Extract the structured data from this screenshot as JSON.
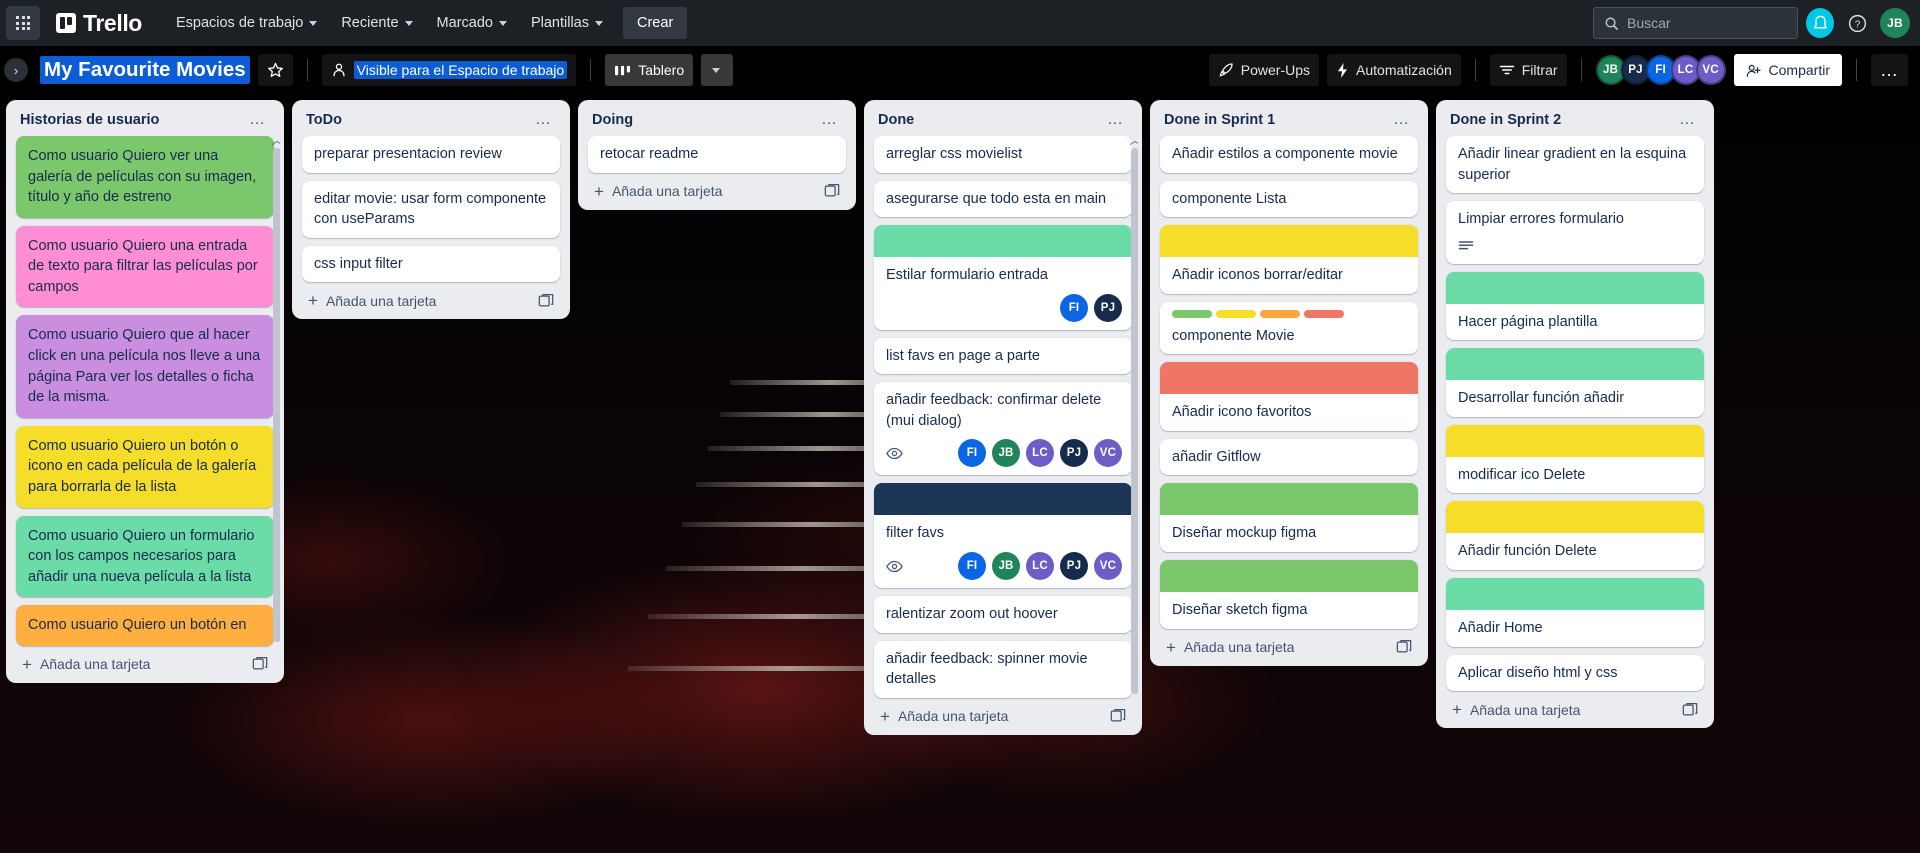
{
  "topnav": {
    "apps_label": "apps",
    "brand": "Trello",
    "items": [
      {
        "label": "Espacios de trabajo"
      },
      {
        "label": "Reciente"
      },
      {
        "label": "Marcado"
      },
      {
        "label": "Plantillas"
      }
    ],
    "create_label": "Crear",
    "search_placeholder": "Buscar",
    "user_initials": "JB",
    "user_color": "#1f845a"
  },
  "boardbar": {
    "title": "My Favourite Movies",
    "star_label": "Destacar tablero",
    "visibility": "Visible para el Espacio de trabajo",
    "view_label": "Tablero",
    "powerups_label": "Power-Ups",
    "automation_label": "Automatización",
    "filter_label": "Filtrar",
    "share_label": "Compartir",
    "more_label": "Más",
    "members": [
      {
        "initials": "JB",
        "color": "#1f845a"
      },
      {
        "initials": "PJ",
        "color": "#172b4d"
      },
      {
        "initials": "FI",
        "color": "#0c66e4"
      },
      {
        "initials": "LC",
        "color": "#6e5dc6"
      },
      {
        "initials": "VC",
        "color": "#6e5dc6"
      }
    ]
  },
  "add_card_label": "Añada una tarjeta",
  "lists": [
    {
      "title": "Historias de usuario",
      "scrollbar": true,
      "cards": [
        {
          "title": "Como usuario Quiero ver una galería de películas con su imagen, título y año de estreno",
          "bg": "#7bc86c"
        },
        {
          "title": "Como usuario Quiero una entrada de texto para filtrar las películas por campos",
          "bg": "#ff8ed4"
        },
        {
          "title": "Como usuario Quiero que al hacer click en una película nos lleve a una página Para ver los detalles o ficha de la misma.",
          "bg": "#c98ee0"
        },
        {
          "title": "Como usuario Quiero un botón o icono en cada película de la galería para borrarla de la lista",
          "bg": "#f5dd29"
        },
        {
          "title": "Como usuario Quiero un formulario con los campos necesarios para añadir una nueva película a la lista",
          "bg": "#6bdba7"
        },
        {
          "title": "Como usuario Quiero un botón en",
          "bg": "#ffaf3f"
        }
      ]
    },
    {
      "title": "ToDo",
      "scrollbar": false,
      "cards": [
        {
          "title": "preparar presentacion review"
        },
        {
          "title": "editar movie: usar form componente con useParams"
        },
        {
          "title": "css input filter"
        }
      ]
    },
    {
      "title": "Doing",
      "scrollbar": false,
      "cards": [
        {
          "title": "retocar readme"
        }
      ]
    },
    {
      "title": "Done",
      "scrollbar": true,
      "cards": [
        {
          "title": "arreglar css movielist"
        },
        {
          "title": "asegurarse que todo esta en main"
        },
        {
          "title": "Estilar formulario entrada",
          "cover": "#6bdba7",
          "members": [
            {
              "initials": "FI",
              "color": "#0c66e4"
            },
            {
              "initials": "PJ",
              "color": "#172b4d"
            }
          ]
        },
        {
          "title": "list favs en page a parte"
        },
        {
          "title": "añadir feedback: confirmar delete (mui dialog)",
          "watching": true,
          "members": [
            {
              "initials": "FI",
              "color": "#0c66e4"
            },
            {
              "initials": "JB",
              "color": "#1f845a"
            },
            {
              "initials": "LC",
              "color": "#6e5dc6"
            },
            {
              "initials": "PJ",
              "color": "#172b4d"
            },
            {
              "initials": "VC",
              "color": "#6e5dc6"
            }
          ]
        },
        {
          "title": "filter favs",
          "cover": "#1d3557",
          "watching": true,
          "members": [
            {
              "initials": "FI",
              "color": "#0c66e4"
            },
            {
              "initials": "JB",
              "color": "#1f845a"
            },
            {
              "initials": "LC",
              "color": "#6e5dc6"
            },
            {
              "initials": "PJ",
              "color": "#172b4d"
            },
            {
              "initials": "VC",
              "color": "#6e5dc6"
            }
          ]
        },
        {
          "title": "ralentizar zoom out hoover"
        },
        {
          "title": "añadir feedback: spinner movie detalles"
        }
      ]
    },
    {
      "title": "Done in Sprint 1",
      "scrollbar": false,
      "cards": [
        {
          "title": "Añadir estilos a componente movie"
        },
        {
          "title": "componente Lista"
        },
        {
          "title": "Añadir iconos borrar/editar",
          "cover": "#f5dd29"
        },
        {
          "title": "componente Movie",
          "labels": [
            "#7bc86c",
            "#f5dd29",
            "#faa53d",
            "#ef7564"
          ]
        },
        {
          "title": "Añadir icono favoritos",
          "cover": "#ef7564"
        },
        {
          "title": "añadir Gitflow"
        },
        {
          "title": "Diseñar mockup figma",
          "cover": "#7bc86c"
        },
        {
          "title": "Diseñar sketch figma",
          "cover": "#7bc86c"
        }
      ]
    },
    {
      "title": "Done in Sprint 2",
      "scrollbar": false,
      "cards": [
        {
          "title": "Añadir linear gradient en la esquina superior"
        },
        {
          "title": "Limpiar errores formulario",
          "description": true
        },
        {
          "title": "Hacer página plantilla",
          "cover": "#6bdba7"
        },
        {
          "title": "Desarrollar función añadir",
          "cover": "#6bdba7"
        },
        {
          "title": "modificar ico Delete",
          "cover": "#f5dd29"
        },
        {
          "title": "Añadir función Delete",
          "cover": "#f5dd29"
        },
        {
          "title": "Añadir Home",
          "cover": "#6bdba7"
        },
        {
          "title": "Aplicar diseño html y css"
        }
      ]
    }
  ]
}
